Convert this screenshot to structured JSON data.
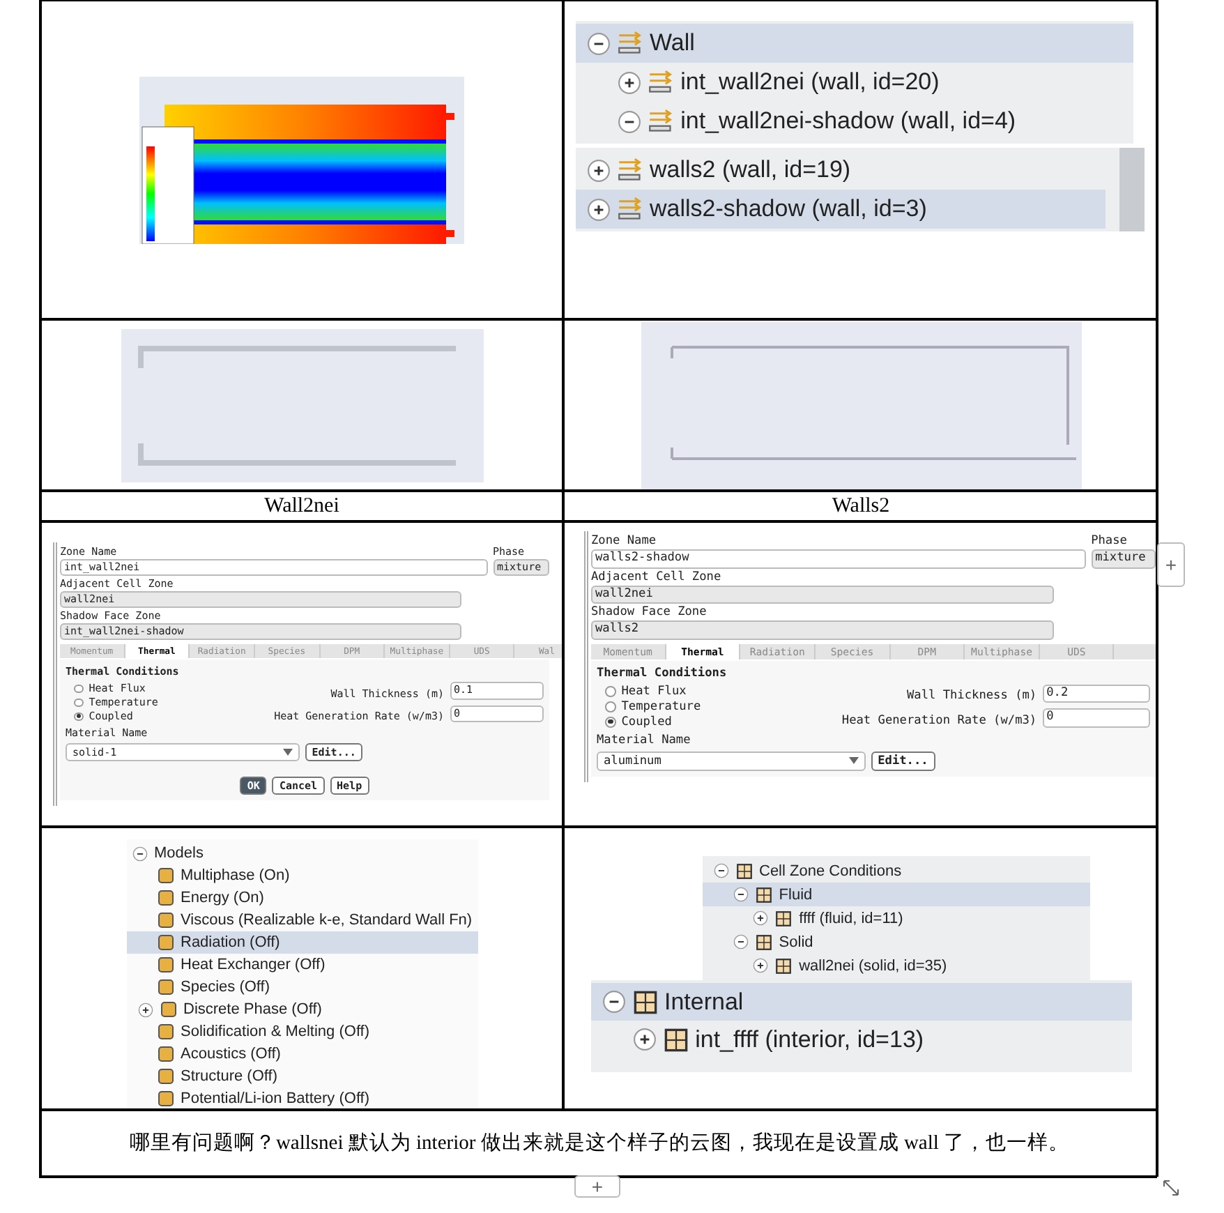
{
  "wall_trees": [
    {
      "nodes": [
        {
          "label": "Wall",
          "kind": "wall",
          "expanded": true,
          "selected": true,
          "children": [
            {
              "label": "int_wall2nei (wall, id=20)",
              "kind": "wall",
              "expanded": false,
              "selected": false
            },
            {
              "label": "int_wall2nei-shadow (wall, id=4)",
              "kind": "wall",
              "expanded": true,
              "selected": false
            }
          ]
        }
      ]
    },
    {
      "nodes": [
        {
          "label": "walls2 (wall, id=19)",
          "kind": "wall",
          "expanded": false,
          "selected": false
        },
        {
          "label": "walls2-shadow (wall, id=3)",
          "kind": "wall",
          "expanded": false,
          "selected": true
        }
      ]
    }
  ],
  "captions": [
    "Wall2nei",
    "Walls2"
  ],
  "dialogs": [
    {
      "zone_name_label": "Zone Name",
      "zone_name": "int_wall2nei",
      "phase_label": "Phase",
      "phase": "mixture",
      "adjacent_label": "Adjacent Cell Zone",
      "adjacent": "wall2nei",
      "shadow_label": "Shadow Face Zone",
      "shadow": "int_wall2nei-shadow",
      "tabs": [
        {
          "label": "Momentum",
          "selected": false
        },
        {
          "label": "Thermal",
          "selected": true
        },
        {
          "label": "Radiation",
          "selected": false
        },
        {
          "label": "Species",
          "selected": false
        },
        {
          "label": "DPM",
          "selected": false
        },
        {
          "label": "Multiphase",
          "selected": false
        },
        {
          "label": "UDS",
          "selected": false
        },
        {
          "label": "Wal",
          "selected": false
        }
      ],
      "section_title": "Thermal Conditions",
      "radios": [
        {
          "label": "Heat Flux",
          "selected": false
        },
        {
          "label": "Temperature",
          "selected": false
        },
        {
          "label": "Coupled",
          "selected": true
        }
      ],
      "wall_thickness_label": "Wall Thickness (m)",
      "wall_thickness": "0.1",
      "heat_gen_label": "Heat Generation Rate (w/m3)",
      "heat_gen": "0",
      "material_label": "Material Name",
      "material": "solid-1",
      "edit_button": "Edit...",
      "buttons": [
        {
          "label": "OK",
          "primary": true
        },
        {
          "label": "Cancel",
          "primary": false
        },
        {
          "label": "Help",
          "primary": false
        }
      ]
    },
    {
      "zone_name_label": "Zone Name",
      "zone_name": "walls2-shadow",
      "phase_label": "Phase",
      "phase": "mixture",
      "adjacent_label": "Adjacent Cell Zone",
      "adjacent": "wall2nei",
      "shadow_label": "Shadow Face Zone",
      "shadow": "walls2",
      "tabs": [
        {
          "label": "Momentum",
          "selected": false
        },
        {
          "label": "Thermal",
          "selected": true
        },
        {
          "label": "Radiation",
          "selected": false
        },
        {
          "label": "Species",
          "selected": false
        },
        {
          "label": "DPM",
          "selected": false
        },
        {
          "label": "Multiphase",
          "selected": false
        },
        {
          "label": "UDS",
          "selected": false
        }
      ],
      "section_title": "Thermal Conditions",
      "radios": [
        {
          "label": "Heat Flux",
          "selected": false
        },
        {
          "label": "Temperature",
          "selected": false
        },
        {
          "label": "Coupled",
          "selected": true
        }
      ],
      "wall_thickness_label": "Wall Thickness (m)",
      "wall_thickness": "0.2",
      "heat_gen_label": "Heat Generation Rate (w/m3)",
      "heat_gen": "0",
      "material_label": "Material Name",
      "material": "aluminum",
      "edit_button": "Edit..."
    }
  ],
  "models_tree": {
    "label": "Models",
    "expanded": true,
    "items": [
      {
        "label": "Multiphase (On)",
        "selected": false
      },
      {
        "label": "Energy (On)",
        "selected": false
      },
      {
        "label": "Viscous (Realizable k-e, Standard Wall Fn)",
        "selected": false
      },
      {
        "label": "Radiation (Off)",
        "selected": true
      },
      {
        "label": "Heat Exchanger (Off)",
        "selected": false
      },
      {
        "label": "Species (Off)",
        "selected": false
      },
      {
        "label": "Discrete Phase (Off)",
        "selected": false,
        "expanded": false
      },
      {
        "label": "Solidification & Melting (Off)",
        "selected": false
      },
      {
        "label": "Acoustics (Off)",
        "selected": false
      },
      {
        "label": "Structure (Off)",
        "selected": false
      },
      {
        "label": "Potential/Li-ion Battery (Off)",
        "selected": false
      }
    ]
  },
  "zone_trees": [
    {
      "nodes": [
        {
          "label": "Cell Zone Conditions",
          "kind": "zone",
          "expanded": true,
          "selected": false,
          "children": [
            {
              "label": "Fluid",
              "kind": "zone",
              "expanded": true,
              "selected": true,
              "children": [
                {
                  "label": "ffff (fluid, id=11)",
                  "kind": "zone",
                  "expanded": false,
                  "selected": false
                }
              ]
            },
            {
              "label": "Solid",
              "kind": "zone",
              "expanded": true,
              "selected": false,
              "children": [
                {
                  "label": "wall2nei (solid, id=35)",
                  "kind": "zone",
                  "expanded": false,
                  "selected": false
                }
              ]
            }
          ]
        }
      ]
    },
    {
      "nodes": [
        {
          "label": "Internal",
          "kind": "zone",
          "expanded": true,
          "selected": true,
          "children": [
            {
              "label": "int_ffff (interior, id=13)",
              "kind": "zone",
              "expanded": false,
              "selected": false
            }
          ]
        }
      ]
    }
  ],
  "question": "哪里有问题啊？wallsnei 默认为 interior 做出来就是这个样子的云图，我现在是设置成 wall 了，也一样。",
  "add_row_button": "+",
  "add_column_button": "+"
}
